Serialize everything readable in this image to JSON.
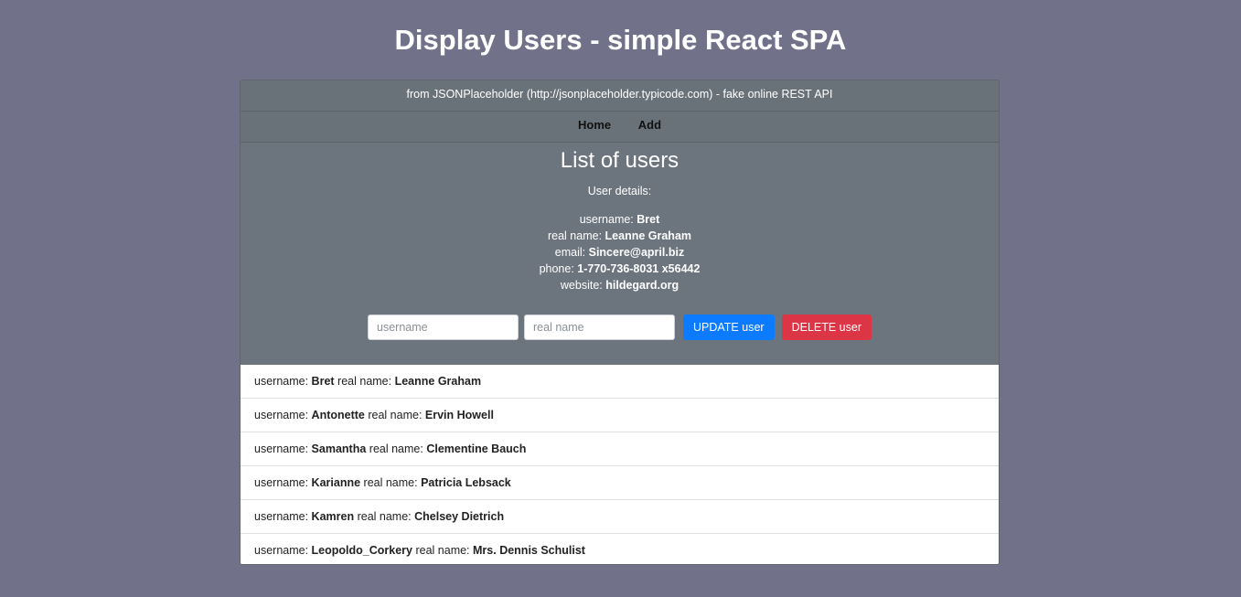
{
  "page": {
    "title": "Display Users - simple React SPA"
  },
  "card": {
    "header": "from JSONPlaceholder (http://jsonplaceholder.typicode.com) - fake online REST API"
  },
  "nav": {
    "home": "Home",
    "add": "Add"
  },
  "details": {
    "title": "List of users",
    "label": "User details:",
    "username_label": "username:",
    "username": "Bret",
    "realname_label": "real name:",
    "realname": "Leanne Graham",
    "email_label": "email:",
    "email": "Sincere@april.biz",
    "phone_label": "phone:",
    "phone": "1-770-736-8031 x56442",
    "website_label": "website:",
    "website": "hildegard.org"
  },
  "form": {
    "username_placeholder": "username",
    "realname_placeholder": "real name",
    "update_label": "UPDATE user",
    "delete_label": "DELETE user"
  },
  "list": {
    "username_label": "username:",
    "realname_label": "real name:",
    "items": [
      {
        "username": "Bret",
        "realname": "Leanne Graham"
      },
      {
        "username": "Antonette",
        "realname": "Ervin Howell"
      },
      {
        "username": "Samantha",
        "realname": "Clementine Bauch"
      },
      {
        "username": "Karianne",
        "realname": "Patricia Lebsack"
      },
      {
        "username": "Kamren",
        "realname": "Chelsey Dietrich"
      },
      {
        "username": "Leopoldo_Corkery",
        "realname": "Mrs. Dennis Schulist"
      }
    ]
  },
  "colors": {
    "background": "#71718a",
    "card": "#6c757d",
    "update": "#0d7bff",
    "delete": "#dc3545"
  }
}
